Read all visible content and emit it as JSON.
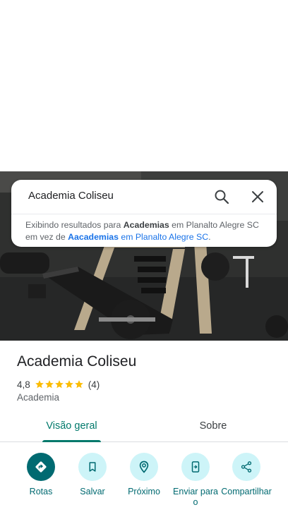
{
  "search": {
    "query": "Academia Coliseu",
    "notice_prefix": "Exibindo resultados para ",
    "notice_term": "Academias",
    "notice_mid": " em Planalto Alegre SC",
    "notice_line2_prefix": "em vez de ",
    "notice_original_term": "Aacademias",
    "notice_original_rest": " em Planalto Alegre SC",
    "notice_period": "."
  },
  "place": {
    "name": "Academia Coliseu",
    "rating": "4,8",
    "rating_value": 4.8,
    "stars": 5,
    "review_count": "(4)",
    "category": "Academia"
  },
  "tabs": [
    {
      "label": "Visão geral",
      "active": true
    },
    {
      "label": "Sobre",
      "active": false
    }
  ],
  "actions": [
    {
      "label": "Rotas",
      "icon": "directions-icon"
    },
    {
      "label": "Salvar",
      "icon": "bookmark-icon"
    },
    {
      "label": "Próximo",
      "icon": "nearby-icon"
    },
    {
      "label": "Enviar para o",
      "icon": "send-to-phone-icon"
    },
    {
      "label": "Compartilhar",
      "icon": "share-icon"
    }
  ],
  "colors": {
    "accent": "#00796b",
    "primary_action": "#006a71",
    "action_bg": "#cdf4f8",
    "star": "#fbbc04"
  }
}
